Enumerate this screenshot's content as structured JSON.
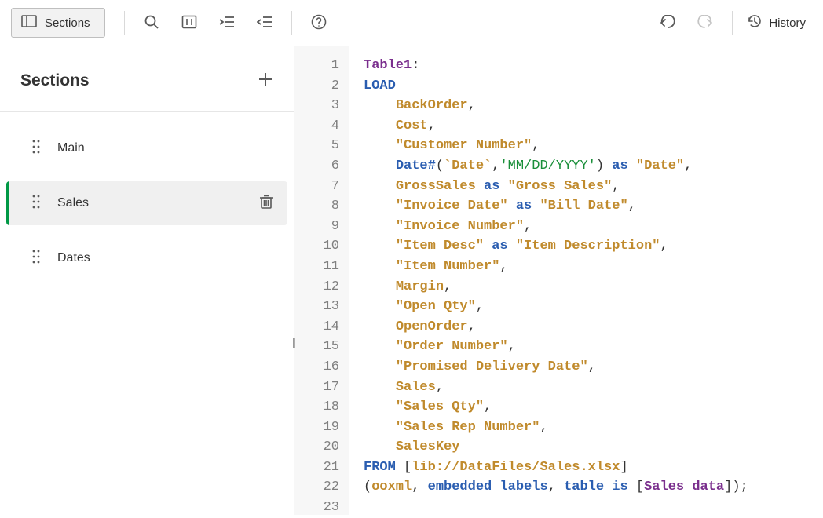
{
  "toolbar": {
    "sections_button": "Sections",
    "history_label": "History"
  },
  "sidebar": {
    "title": "Sections",
    "items": [
      {
        "label": "Main",
        "active": false
      },
      {
        "label": "Sales",
        "active": true
      },
      {
        "label": "Dates",
        "active": false
      }
    ]
  },
  "editor": {
    "line_numbers": [
      "1",
      "2",
      "3",
      "4",
      "5",
      "6",
      "7",
      "8",
      "9",
      "10",
      "11",
      "12",
      "13",
      "14",
      "15",
      "16",
      "17",
      "18",
      "19",
      "20",
      "21",
      "22",
      "23"
    ],
    "script": {
      "table_name": "Table1",
      "load_kw": "LOAD",
      "from_kw": "FROM",
      "as_kw": "as",
      "is_kw": "is",
      "table_kw": "table",
      "embedded_kw": "embedded",
      "labels_kw": "labels",
      "ooxml": "ooxml",
      "date_fn": "Date#",
      "date_backtick": "`Date`",
      "date_fmt": "'MM/DD/YYYY'",
      "source_path": "lib://DataFiles/Sales.xlsx",
      "sheet_name": "Sales data",
      "fields": {
        "BackOrder": "BackOrder",
        "Cost": "Cost",
        "CustomerNumber": "\"Customer Number\"",
        "DateAlias": "\"Date\"",
        "GrossSales": "GrossSales",
        "GrossSalesAlias": "\"Gross Sales\"",
        "InvoiceDate": "\"Invoice Date\"",
        "BillDate": "\"Bill Date\"",
        "InvoiceNumber": "\"Invoice Number\"",
        "ItemDesc": "\"Item Desc\"",
        "ItemDescription": "\"Item Description\"",
        "ItemNumber": "\"Item Number\"",
        "Margin": "Margin",
        "OpenQty": "\"Open Qty\"",
        "OpenOrder": "OpenOrder",
        "OrderNumber": "\"Order Number\"",
        "PromisedDeliveryDate": "\"Promised Delivery Date\"",
        "Sales": "Sales",
        "SalesQty": "\"Sales Qty\"",
        "SalesRepNumber": "\"Sales Rep Number\"",
        "SalesKey": "SalesKey"
      }
    }
  }
}
